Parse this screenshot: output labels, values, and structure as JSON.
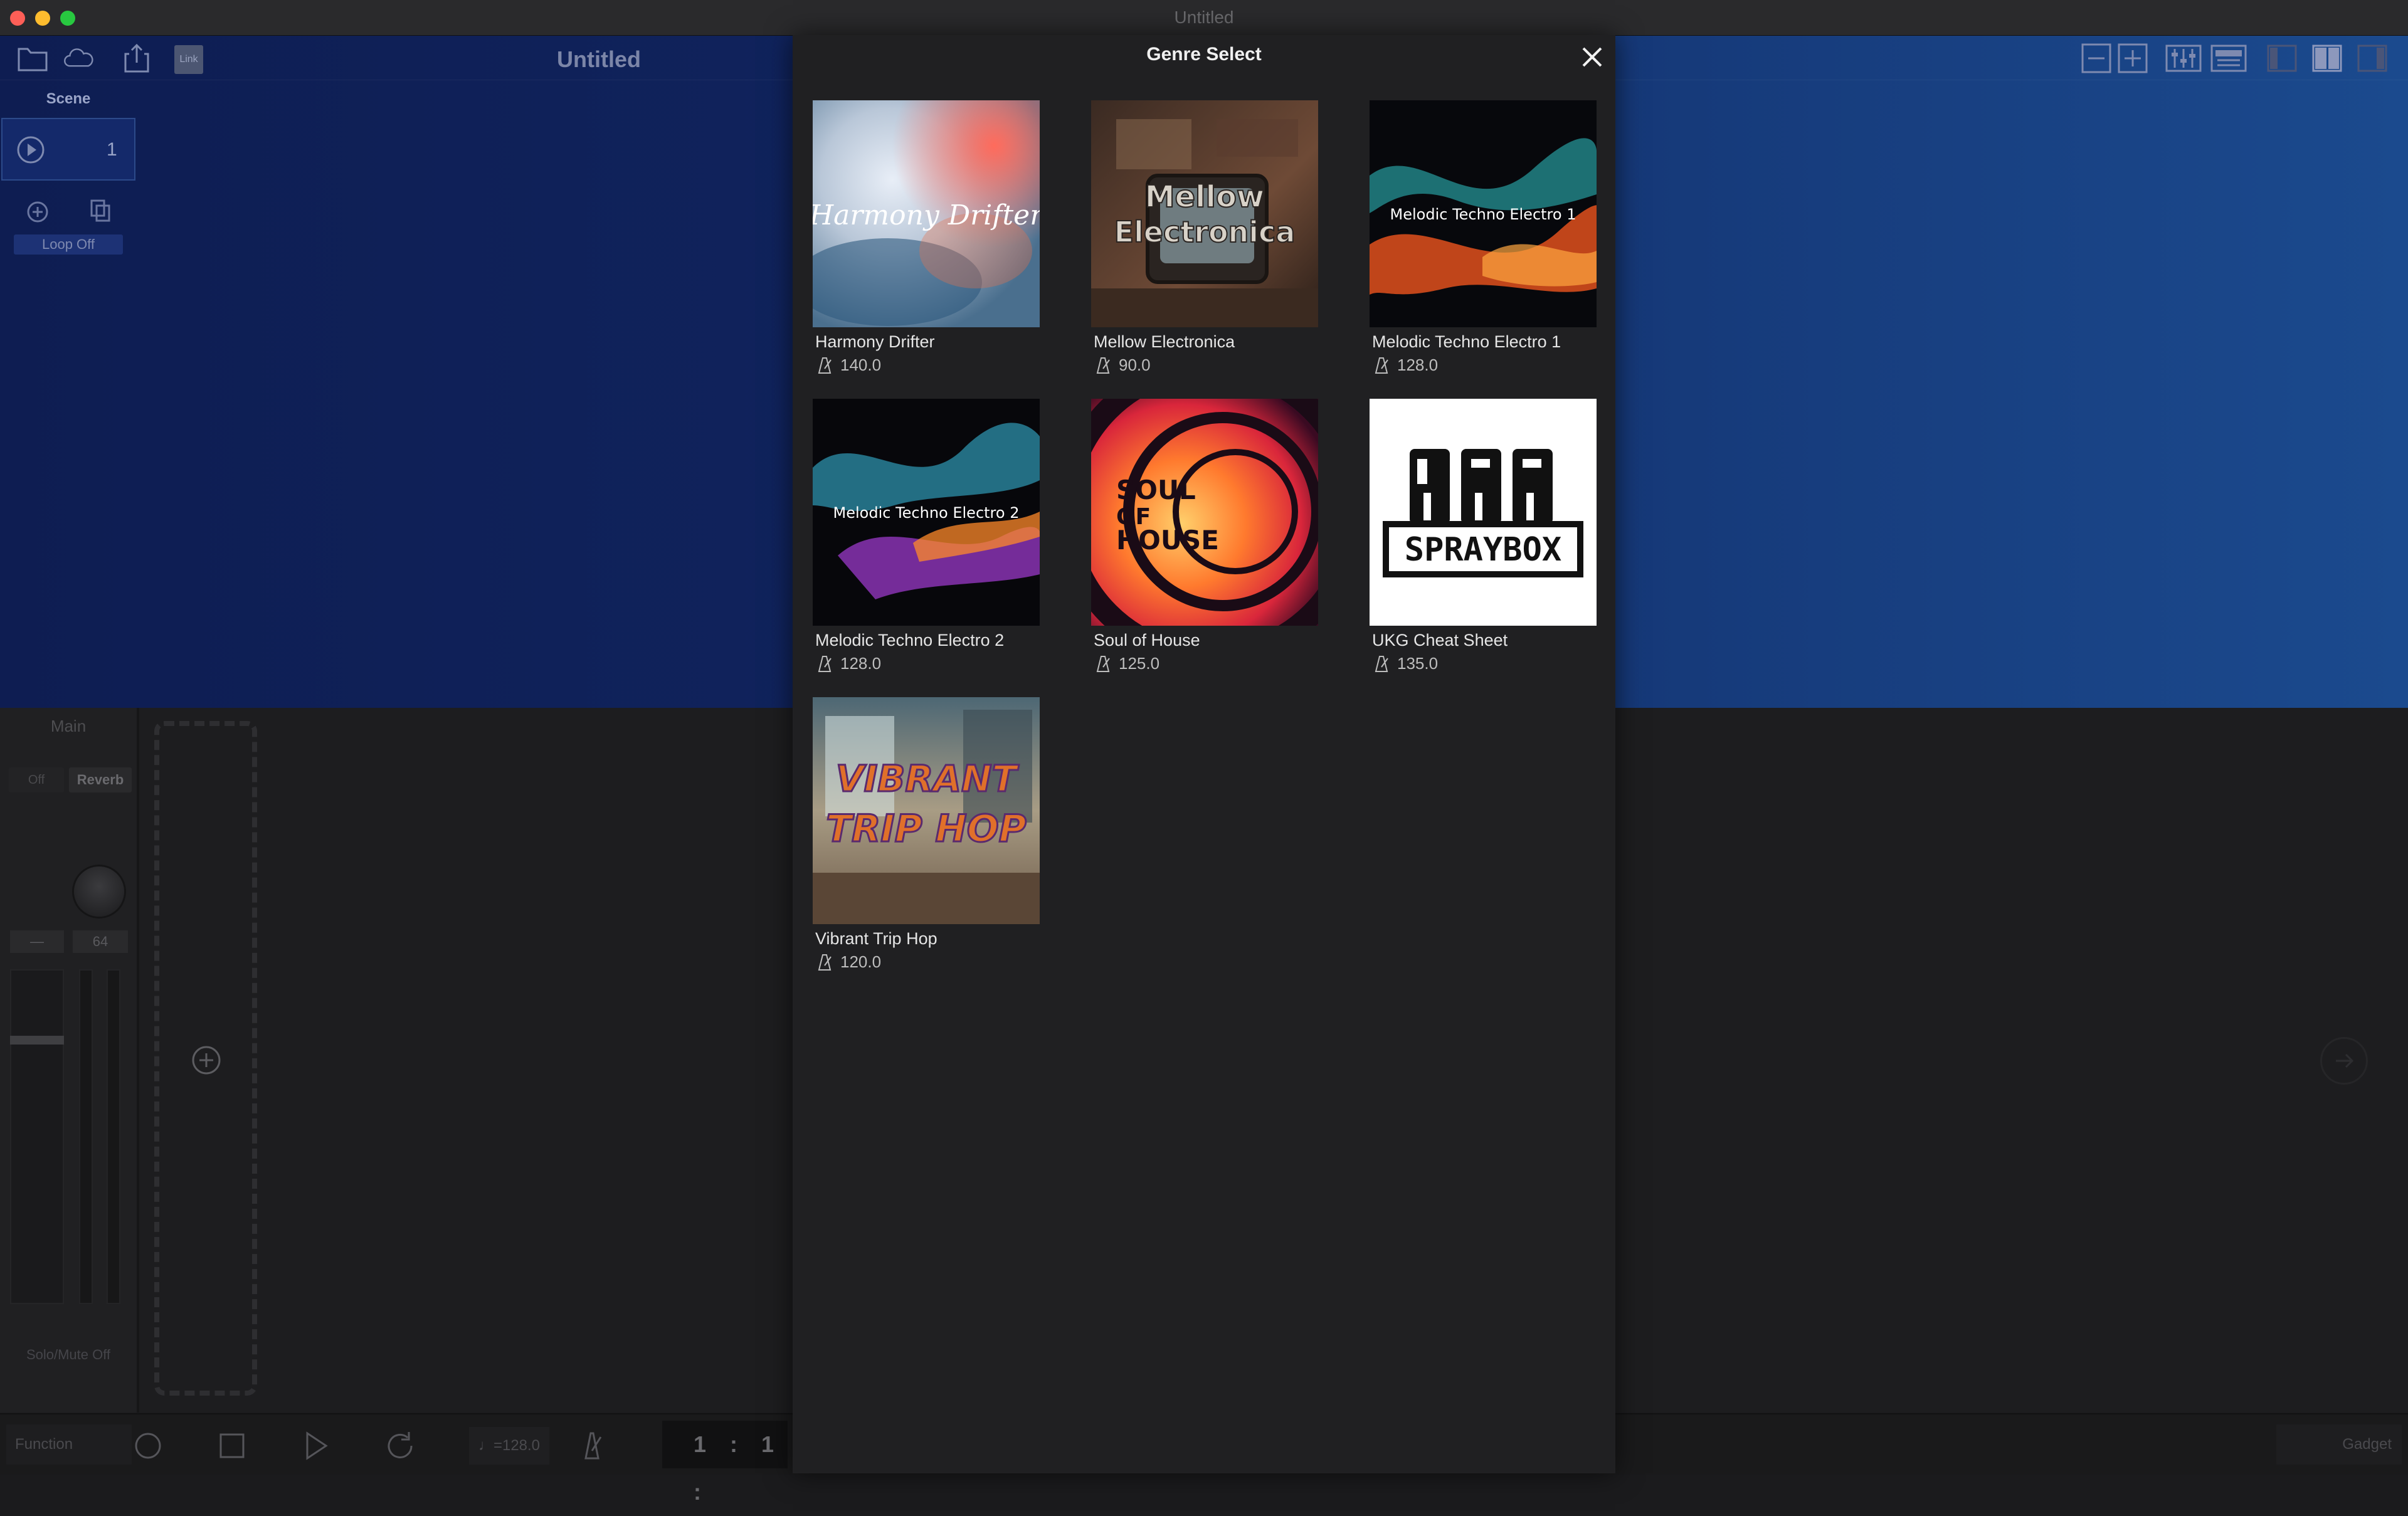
{
  "window": {
    "title": "Untitled"
  },
  "toolbar": {
    "document_title": "Untitled",
    "link_label": "Link"
  },
  "scene_panel": {
    "label": "Scene",
    "scene_number": "1",
    "loop_label": "Loop Off"
  },
  "mixer": {
    "main_label": "Main",
    "send_tabs": [
      "Off",
      "Reverb"
    ],
    "left_value": "—",
    "right_value": "64",
    "solo_mute_label": "Solo/Mute Off"
  },
  "bottom_bar": {
    "function_label": "Function",
    "tempo_label": "♩=128.0",
    "position": "1 : 1 :",
    "gadget_label": "Gadget"
  },
  "modal": {
    "title": "Genre Select",
    "genres": [
      {
        "name": "Harmony Drifter",
        "bpm": "140.0",
        "cover_text": "Harmony Drifter"
      },
      {
        "name": "Mellow Electronica",
        "bpm": "90.0",
        "cover_text": "Mellow Electronica"
      },
      {
        "name": "Melodic Techno Electro 1",
        "bpm": "128.0",
        "cover_text": "Melodic Techno Electro 1"
      },
      {
        "name": "Melodic Techno Electro 2",
        "bpm": "128.0",
        "cover_text": "Melodic Techno Electro 2"
      },
      {
        "name": "Soul of House",
        "bpm": "125.0",
        "cover_text": "SOUL OF HOUSE"
      },
      {
        "name": "UKG Cheat Sheet",
        "bpm": "135.0",
        "cover_text": "SPRAYBOX"
      },
      {
        "name": "Vibrant Trip Hop",
        "bpm": "120.0",
        "cover_text": "VIBRANT TRIP HOP"
      }
    ]
  },
  "colors": {
    "accent_red": "#fe5f57",
    "accent_yellow": "#febc2e",
    "accent_green": "#28c840",
    "scene_blue": "#10245e"
  }
}
